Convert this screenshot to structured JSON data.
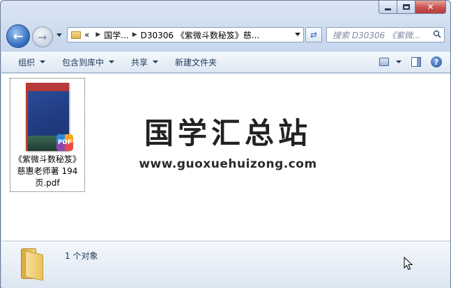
{
  "window": {
    "controls": {
      "minimize": "minimize",
      "maximize": "maximize",
      "close": "✕"
    }
  },
  "nav": {
    "breadcrumb": {
      "overflow": "«",
      "items": [
        "国学...",
        "D30306 《紫微斗数秘笈》慈..."
      ]
    },
    "search_placeholder": "搜索 D30306 《紫微..."
  },
  "toolbar": {
    "items": [
      {
        "label": "组织",
        "dropdown": true
      },
      {
        "label": "包含到库中",
        "dropdown": true
      },
      {
        "label": "共享",
        "dropdown": true
      },
      {
        "label": "新建文件夹",
        "dropdown": false
      }
    ],
    "help": "?"
  },
  "content": {
    "file": {
      "name": "《紫微斗数秘笈》慈惠老师著 194页.pdf",
      "badge": "PDF"
    },
    "watermark": {
      "title": "国学汇总站",
      "url": "www.guoxuehuizong.com"
    }
  },
  "details": {
    "status": "1 个对象"
  },
  "colors": {
    "accent": "#2a6bc5",
    "close": "#c75050",
    "folder": "#f4d37a"
  }
}
